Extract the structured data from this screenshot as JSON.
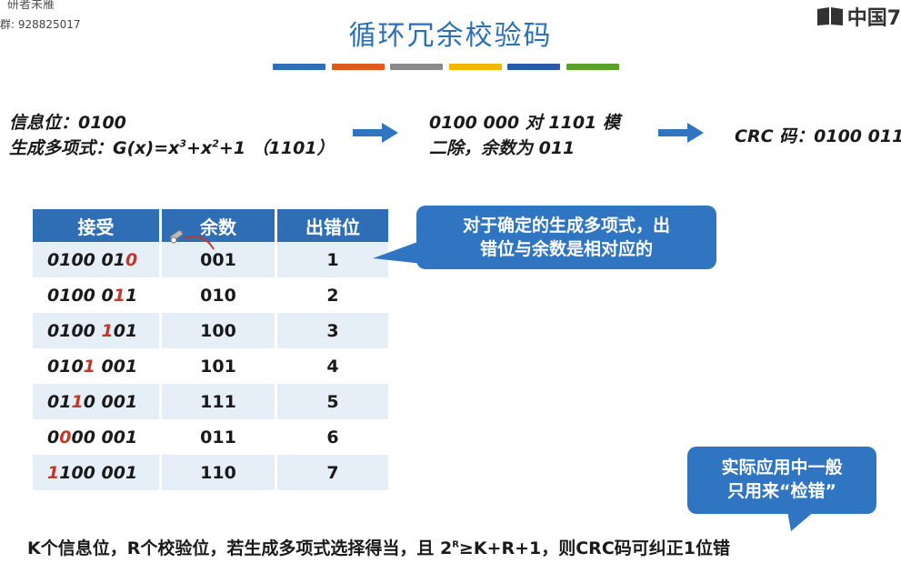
{
  "watermark": {
    "top_text": "研者未雁",
    "group_text": "群: 928825017"
  },
  "title": "循环冗余校验码",
  "logo": {
    "text": "中国7"
  },
  "color_bars": [
    "#2f6db5",
    "#e05a1e",
    "#8a8a8a",
    "#f2b800",
    "#2a5aa8",
    "#5aa02c"
  ],
  "info": {
    "line1": "信息位：0100",
    "line2_prefix": "生成多项式：G(x)=x",
    "exp3": "3",
    "plus": "+x",
    "exp2": "2",
    "line2_suffix": "+1 （1101）"
  },
  "middle": {
    "line1": "0100 000 对 1101 模",
    "line2": "二除，余数为 011"
  },
  "result": "CRC 码：0100 011",
  "table": {
    "headers": [
      "接受",
      "余数",
      "出错位"
    ],
    "rows": [
      {
        "pre": "0100 01",
        "err": "0",
        "post": "",
        "rem": "001",
        "pos": "1"
      },
      {
        "pre": "0100 0",
        "err": "1",
        "post": "1",
        "rem": "010",
        "pos": "2"
      },
      {
        "pre": "0100 ",
        "err": "1",
        "post": "01",
        "rem": "100",
        "pos": "3"
      },
      {
        "pre": "010",
        "err": "1",
        "post": " 001",
        "rem": "101",
        "pos": "4"
      },
      {
        "pre": "01",
        "err": "1",
        "post": "0 001",
        "rem": "111",
        "pos": "5"
      },
      {
        "pre": "0",
        "err": "0",
        "post": "00 001",
        "rem": "011",
        "pos": "6"
      },
      {
        "pre": "",
        "err": "1",
        "post": "100 001",
        "rem": "110",
        "pos": "7"
      }
    ]
  },
  "callout1": {
    "line1": "对于确定的生成多项式，出",
    "line2": "错位与余数是相对应的"
  },
  "callout2": {
    "line1": "实际应用中一般",
    "line2": "只用来“检错”"
  },
  "bottom": {
    "part1": "K个信息位，R个校验位，若生成多项式选择得当，且 2",
    "sup": "R",
    "part2": "≥K+R+1，则CRC码可纠正1位错"
  }
}
